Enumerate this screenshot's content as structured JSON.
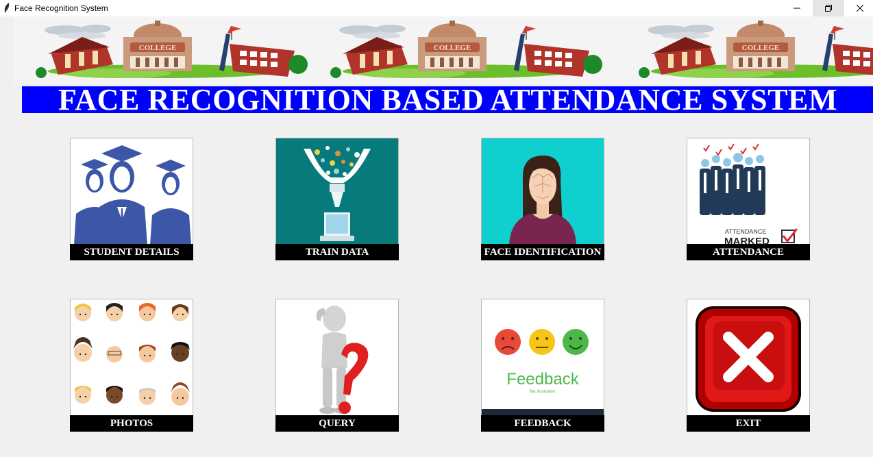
{
  "window": {
    "title": "Face Recognition System",
    "controls": [
      "minimize",
      "maximize",
      "close"
    ]
  },
  "header": {
    "banner_image": "college-banner",
    "banner_text": "COLLEGE",
    "title": "FACE RECOGNITION BASED ATTENDANCE SYSTEM",
    "title_bg": "#0000ff",
    "title_color": "#ffffff"
  },
  "buttons": [
    {
      "label": "STUDENT DETAILS",
      "icon": "graduates-icon"
    },
    {
      "label": "TRAIN DATA",
      "icon": "data-funnel-icon"
    },
    {
      "label": "FACE IDENTIFICATION",
      "icon": "face-scan-icon"
    },
    {
      "label": "ATTENDANCE",
      "icon": "attendance-marked-icon"
    },
    {
      "label": "PHOTOS",
      "icon": "faces-grid-icon"
    },
    {
      "label": "QUERY",
      "icon": "question-person-icon"
    },
    {
      "label": "FEEDBACK",
      "icon": "feedback-smileys-icon"
    },
    {
      "label": "EXIT",
      "icon": "exit-x-icon"
    }
  ],
  "attendance_image_text": [
    "ATTENDANCE",
    "MARKED"
  ],
  "feedback_image_text": "Feedback",
  "feedback_image_subtext": "flat illustration"
}
